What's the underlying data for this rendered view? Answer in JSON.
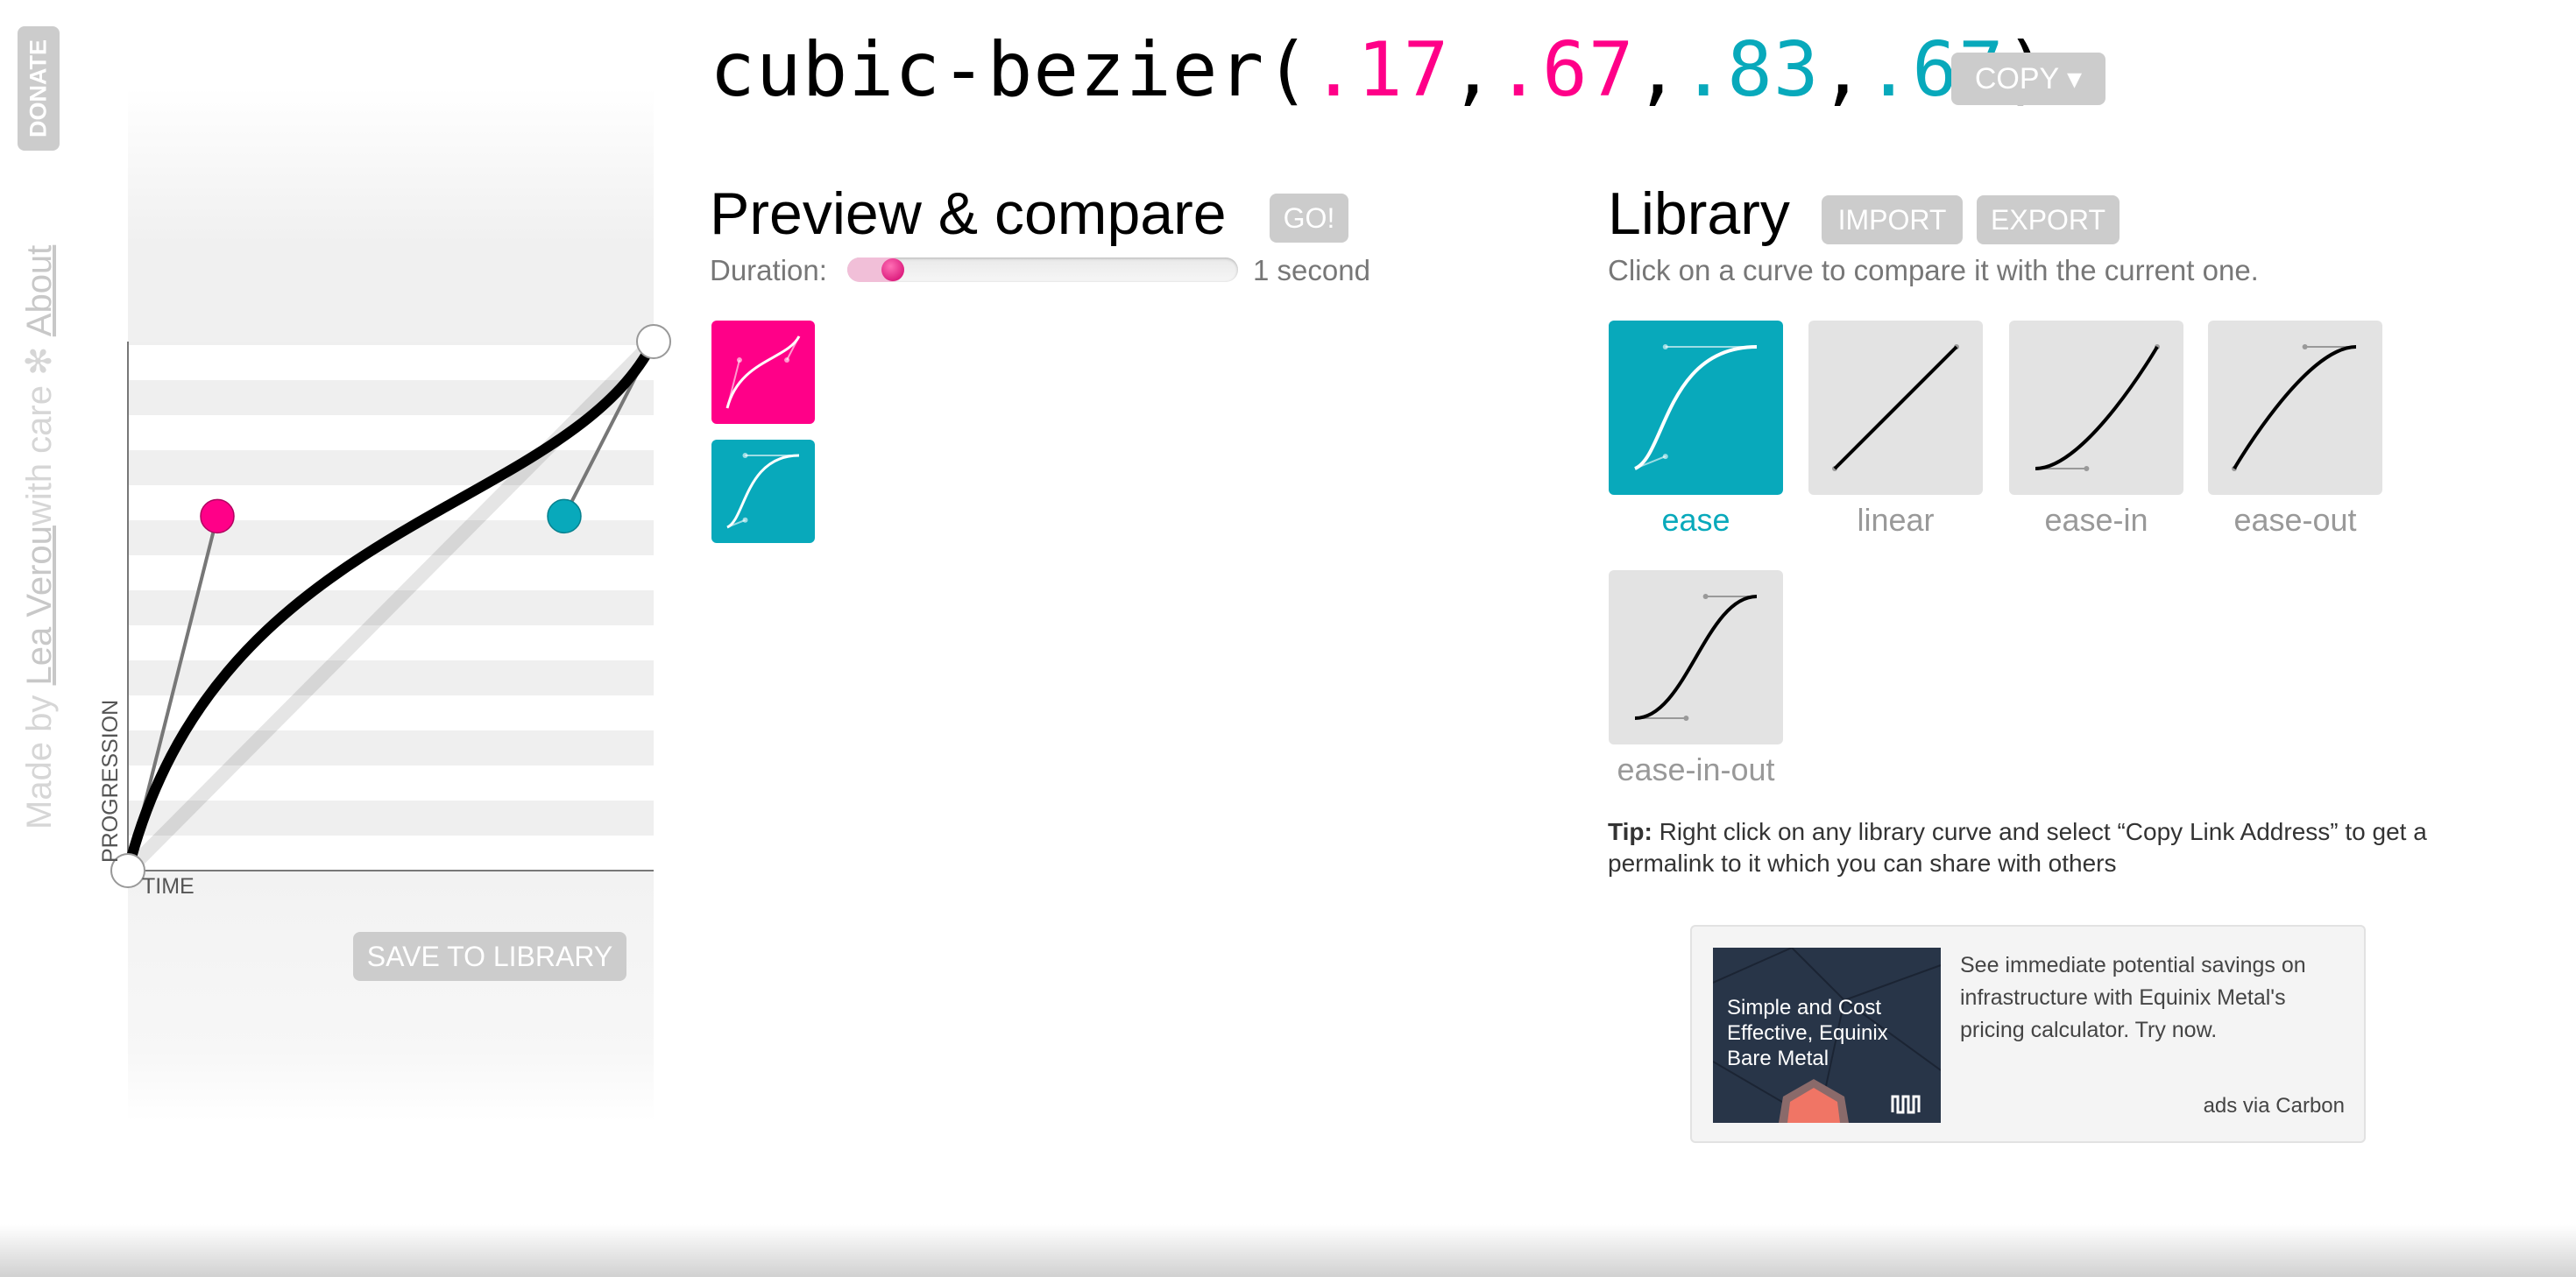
{
  "sidebar": {
    "donate_label": "DONATE",
    "made_by": "Made by ",
    "author": "Lea Verou",
    "with_care": " with care ",
    "star_icon": "✻",
    "about": "About"
  },
  "bezier": {
    "values": [
      0.17,
      0.67,
      0.83,
      0.67
    ],
    "prefix": "cubic-bezier(",
    "v1": ".17",
    "v2": ".67",
    "v3": ".83",
    "v4": ".67",
    "sep": ",",
    "suffix": ")"
  },
  "colors": {
    "pink": "#ff0088",
    "teal": "#08a9bb",
    "button": "#cccccc"
  },
  "copy_label": "COPY ▾",
  "graph": {
    "ylabel": "PROGRESSION",
    "xlabel": "TIME",
    "save_label": "SAVE TO LIBRARY"
  },
  "preview": {
    "title": "Preview & compare",
    "go_label": "GO!",
    "duration_label": "Duration:",
    "duration_value": "1 second",
    "duration_fraction": 0.06
  },
  "library": {
    "title": "Library",
    "import_label": "IMPORT",
    "export_label": "EXPORT",
    "subtitle": "Click on a curve to compare it with the current one.",
    "items": [
      {
        "label": "ease",
        "curve": [
          0.25,
          0.1,
          0.25,
          1
        ],
        "active": true
      },
      {
        "label": "linear",
        "curve": [
          0,
          0,
          1,
          1
        ],
        "active": false
      },
      {
        "label": "ease-in",
        "curve": [
          0.42,
          0,
          1,
          1
        ],
        "active": false
      },
      {
        "label": "ease-out",
        "curve": [
          0,
          0,
          0.58,
          1
        ],
        "active": false
      },
      {
        "label": "ease-in-out",
        "curve": [
          0.42,
          0,
          0.58,
          1
        ],
        "active": false
      }
    ],
    "tip_bold": "Tip:",
    "tip_text": " Right click on any library curve and select “Copy Link Address” to get a permalink to it which you can share with others"
  },
  "ad": {
    "image_text": "Simple and Cost Effective, Equinix Bare Metal",
    "text": "See immediate potential savings on infrastructure with Equinix Metal's pricing calculator. Try now.",
    "via": "ads via Carbon"
  }
}
